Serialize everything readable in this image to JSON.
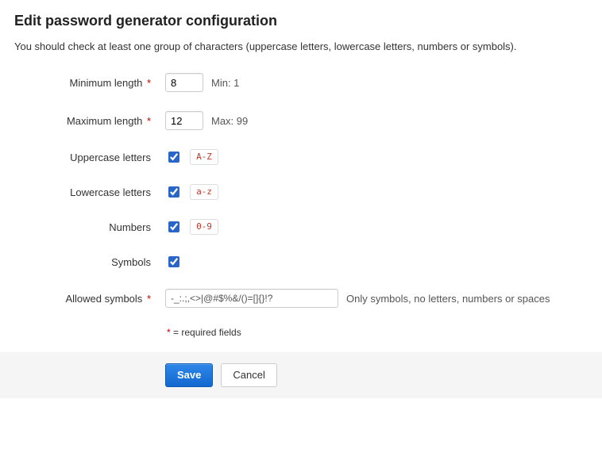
{
  "title": "Edit password generator configuration",
  "intro": "You should check at least one group of characters (uppercase letters, lowercase letters, numbers or symbols).",
  "form": {
    "min_length": {
      "label": "Minimum length",
      "value": "8",
      "hint": "Min: 1",
      "required": true
    },
    "max_length": {
      "label": "Maximum length",
      "value": "12",
      "hint": "Max: 99",
      "required": true
    },
    "uppercase": {
      "label": "Uppercase letters",
      "checked": true,
      "badge": "A-Z"
    },
    "lowercase": {
      "label": "Lowercase letters",
      "checked": true,
      "badge": "a-z"
    },
    "numbers": {
      "label": "Numbers",
      "checked": true,
      "badge": "0-9"
    },
    "symbols": {
      "label": "Symbols",
      "checked": true
    },
    "allowed_symbols": {
      "label": "Allowed symbols",
      "value": "-_:.;,<>|@#$%&/()=[]{}!?",
      "hint": "Only symbols, no letters, numbers or spaces",
      "required": true
    }
  },
  "required_note": "= required fields",
  "actions": {
    "save": "Save",
    "cancel": "Cancel"
  }
}
